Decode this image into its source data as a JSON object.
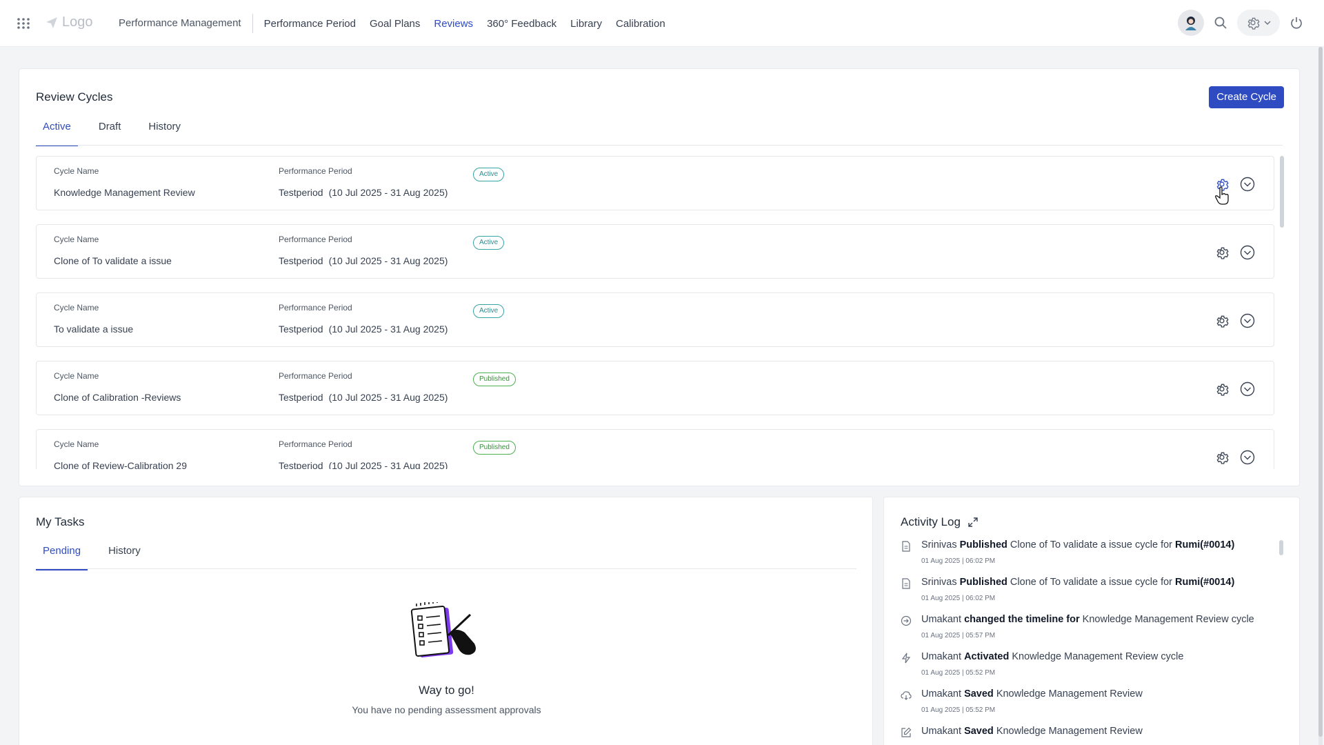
{
  "topbar": {
    "logo_text": "Logo",
    "module": "Performance Management",
    "nav": [
      "Performance Period",
      "Goal Plans",
      "Reviews",
      "360° Feedback",
      "Library",
      "Calibration"
    ],
    "active_nav": "Reviews",
    "icons": [
      "apps-grid-icon",
      "avatar",
      "search-icon",
      "gear-icon",
      "chevron-down-icon",
      "power-icon"
    ]
  },
  "review_cycles": {
    "title": "Review Cycles",
    "create_label": "Create Cycle",
    "tabs": [
      "Active",
      "Draft",
      "History"
    ],
    "active_tab": "Active",
    "col_name_label": "Cycle Name",
    "col_period_label": "Performance Period",
    "rows": [
      {
        "name": "Knowledge Management Review",
        "period": "Testperiod",
        "dates": "(10 Jul 2025 - 31 Aug 2025)",
        "status": "Active"
      },
      {
        "name": "Clone of To validate a issue",
        "period": "Testperiod",
        "dates": "(10 Jul 2025 - 31 Aug 2025)",
        "status": "Active"
      },
      {
        "name": "To validate a issue",
        "period": "Testperiod",
        "dates": "(10 Jul 2025 - 31 Aug 2025)",
        "status": "Active"
      },
      {
        "name": "Clone of Calibration -Reviews",
        "period": "Testperiod",
        "dates": "(10 Jul 2025 - 31 Aug 2025)",
        "status": "Published"
      },
      {
        "name": "Clone of Review-Calibration 29",
        "period": "Testperiod",
        "dates": "(10 Jul 2025 - 31 Aug 2025)",
        "status": "Published"
      }
    ]
  },
  "my_tasks": {
    "title": "My Tasks",
    "tabs": [
      "Pending",
      "History"
    ],
    "active_tab": "Pending",
    "empty_title": "Way to go!",
    "empty_subtitle": "You have no pending assessment approvals"
  },
  "activity_log": {
    "title": "Activity Log",
    "items": [
      {
        "icon": "document-icon",
        "actor": "Srinivas",
        "action": "Published",
        "rest": " Clone of To validate a issue cycle for ",
        "target": "Rumi(#0014)",
        "date": "01 Aug 2025",
        "time": "06:02 PM"
      },
      {
        "icon": "document-icon",
        "actor": "Srinivas",
        "action": "Published",
        "rest": " Clone of To validate a issue cycle for ",
        "target": "Rumi(#0014)",
        "date": "01 Aug 2025",
        "time": "06:02 PM"
      },
      {
        "icon": "arrow-circle-icon",
        "actor": "Umakant",
        "action": "changed the timeline for",
        "rest": " Knowledge Management Review cycle",
        "target": "",
        "date": "01 Aug 2025",
        "time": "05:57 PM"
      },
      {
        "icon": "lightning-icon",
        "actor": "Umakant",
        "action": "Activated",
        "rest": " Knowledge Management Review cycle",
        "target": "",
        "date": "01 Aug 2025",
        "time": "05:52 PM"
      },
      {
        "icon": "cloud-save-icon",
        "actor": "Umakant",
        "action": "Saved",
        "rest": " Knowledge Management Review",
        "target": "",
        "date": "01 Aug 2025",
        "time": "05:52 PM"
      },
      {
        "icon": "edit-icon",
        "actor": "Umakant",
        "action": "Saved",
        "rest": " Knowledge Management Review",
        "target": "",
        "date": "",
        "time": ""
      }
    ]
  }
}
